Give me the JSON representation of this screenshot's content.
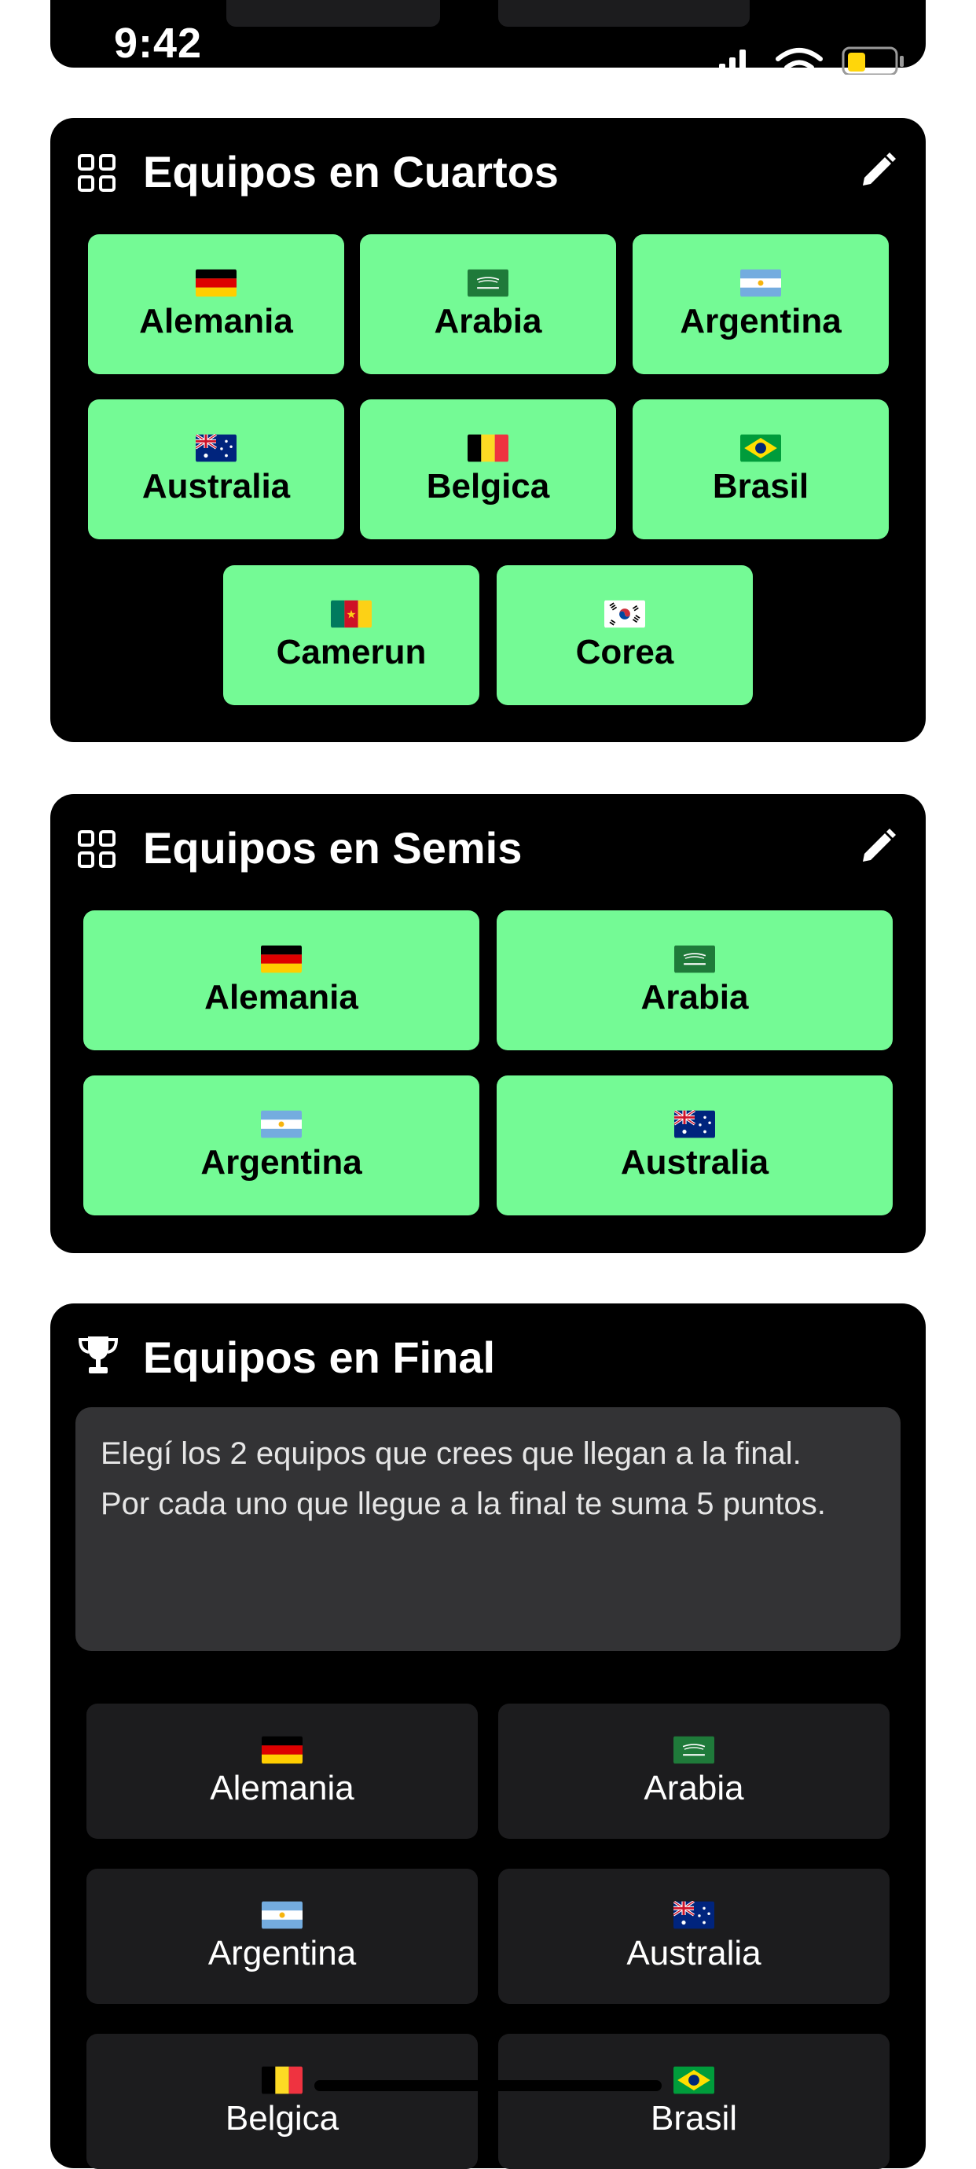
{
  "status_bar": {
    "time": "9:42"
  },
  "quarters": {
    "title": "Equipos en Cuartos",
    "teams": [
      {
        "name": "Alemania",
        "flag": "germany-flag"
      },
      {
        "name": "Arabia",
        "flag": "saudi-arabia-flag"
      },
      {
        "name": "Argentina",
        "flag": "argentina-flag"
      },
      {
        "name": "Australia",
        "flag": "australia-flag"
      },
      {
        "name": "Belgica",
        "flag": "belgium-flag"
      },
      {
        "name": "Brasil",
        "flag": "brazil-flag"
      },
      {
        "name": "Camerun",
        "flag": "cameroon-flag"
      },
      {
        "name": "Corea",
        "flag": "south-korea-flag"
      }
    ]
  },
  "semis": {
    "title": "Equipos en Semis",
    "teams": [
      {
        "name": "Alemania",
        "flag": "germany-flag"
      },
      {
        "name": "Arabia",
        "flag": "saudi-arabia-flag"
      },
      {
        "name": "Argentina",
        "flag": "argentina-flag"
      },
      {
        "name": "Australia",
        "flag": "australia-flag"
      }
    ]
  },
  "final": {
    "title": "Equipos en Final",
    "info_line1": "Elegí los 2 equipos que crees que llegan a la final.",
    "info_line2": "Por cada uno que llegue a la final te suma 5 puntos.",
    "teams": [
      {
        "name": "Alemania",
        "flag": "germany-flag"
      },
      {
        "name": "Arabia",
        "flag": "saudi-arabia-flag"
      },
      {
        "name": "Argentina",
        "flag": "argentina-flag"
      },
      {
        "name": "Australia",
        "flag": "australia-flag"
      },
      {
        "name": "Belgica",
        "flag": "belgium-flag"
      },
      {
        "name": "Brasil",
        "flag": "brazil-flag"
      }
    ]
  },
  "colors": {
    "selected_team": "#74fa95",
    "unselected_team": "#1c1c1e",
    "card_background": "#000000"
  }
}
